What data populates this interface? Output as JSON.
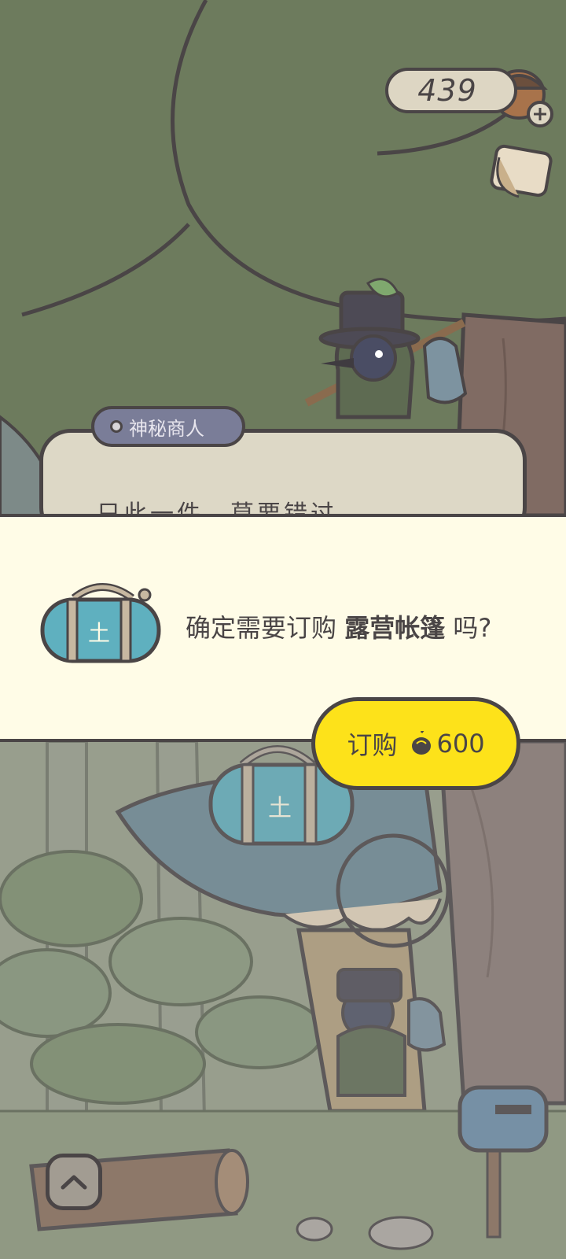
{
  "hud": {
    "acorn_count": "439",
    "acorn_icon": "acorn-plus-icon",
    "bag_icon": "inventory-bag-icon"
  },
  "merchant": {
    "name_tag": "神秘商人",
    "dialogue_partial": "只此一件，莫要错过"
  },
  "dialog": {
    "question_prefix": "确定需要订购",
    "item_name": "露营帐篷",
    "question_suffix": "吗?",
    "item_icon": "duffel-bag-icon",
    "buy_label": "订购",
    "price": "600",
    "price_icon": "acorn-icon"
  },
  "bottom": {
    "up_icon": "chevron-up-icon",
    "mailbox_icon": "mailbox-icon"
  },
  "colors": {
    "accent_yellow": "#fde21a",
    "outline": "#4a4546",
    "dialog_bg": "#fffce7",
    "tree_green": "#6b7a5c",
    "tag_purple": "#7a7d98"
  }
}
